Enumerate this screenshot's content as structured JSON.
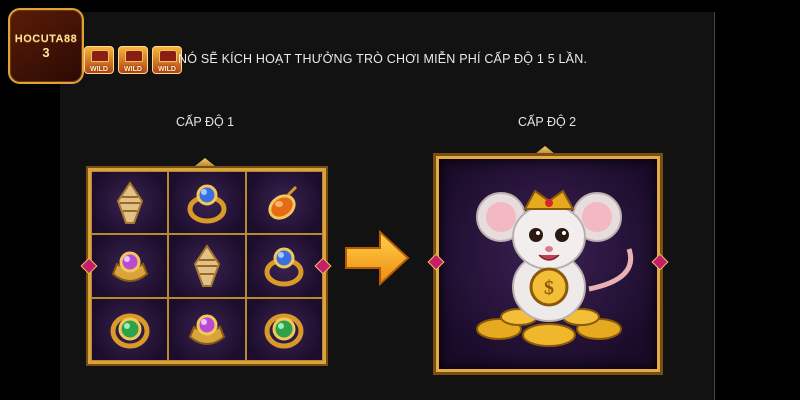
{
  "brand": {
    "name": "HOCUTA88",
    "number": "3"
  },
  "wild_icons": [
    {
      "label": "WILD",
      "icon": "wild-chest-icon"
    },
    {
      "label": "WILD",
      "icon": "wild-chest-icon"
    },
    {
      "label": "WILD",
      "icon": "wild-chest-icon"
    }
  ],
  "description": "NÓ SẼ KÍCH HOẠT THƯỞNG TRÒ CHƠI MIỄN PHÍ CẤP ĐỘ 1 5 LẦN.",
  "level1": {
    "label": "CẤP ĐỘ 1",
    "symbols": [
      "shell-icon",
      "blue-gem-ring-icon",
      "orange-gem-pendant-icon",
      "purple-gem-crown-icon",
      "shell-icon",
      "blue-gem-ring-icon",
      "green-gem-ring-icon",
      "purple-gem-crown-icon",
      "green-gem-ring-icon"
    ]
  },
  "level2": {
    "label": "CẤP ĐỘ 2",
    "symbol": "golden-rat-icon"
  },
  "colors": {
    "frame_gold": "#d9a43c",
    "panel_purple": "#241238",
    "arrow": "#f6a31c"
  }
}
